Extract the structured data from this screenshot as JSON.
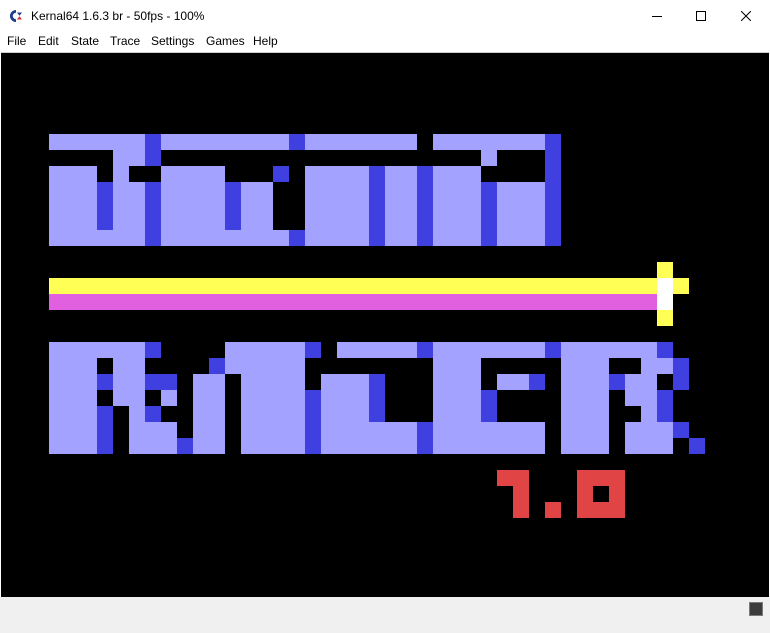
{
  "window": {
    "title": "Kernal64 1.6.3 br - 50fps - 100%",
    "icon": "commodore-logo-icon"
  },
  "menu": [
    "File",
    "Edit",
    "State",
    "Trace",
    "Settings",
    "Games",
    "Help"
  ],
  "screen": {
    "logo_line_1": "BEAM",
    "logo_line_2": "RACER",
    "version": "1.0",
    "colors": {
      "background": "#000000",
      "logo_fill": "#a3a3ff",
      "logo_shadow": "#4040e0",
      "beam_yellow": "#ffff55",
      "beam_magenta": "#e060e0",
      "beam_tip": "#ffffff",
      "version_red": "#e04444"
    }
  },
  "statusbar": {
    "indicator": "drive-led-icon"
  }
}
